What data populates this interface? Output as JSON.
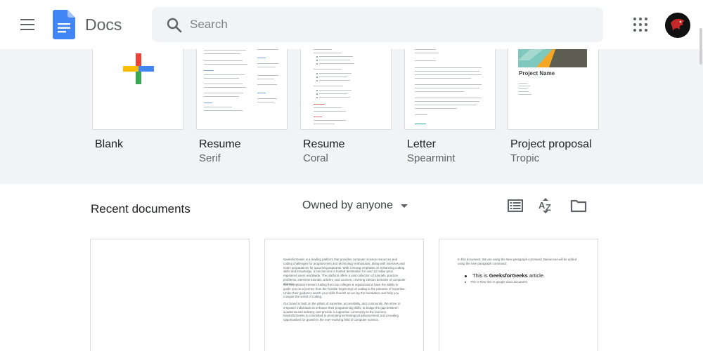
{
  "header": {
    "app_name": "Docs",
    "search_placeholder": "Search"
  },
  "templates": [
    {
      "name": "Blank",
      "subtitle": ""
    },
    {
      "name": "Resume",
      "subtitle": "Serif"
    },
    {
      "name": "Resume",
      "subtitle": "Coral"
    },
    {
      "name": "Letter",
      "subtitle": "Spearmint"
    },
    {
      "name": "Project proposal",
      "subtitle": "Tropic"
    }
  ],
  "proposal_thumb_title": "Project Name",
  "recent": {
    "title": "Recent documents",
    "owner_filter": "Owned by anyone"
  },
  "docs": {
    "doc2_text": "GeeksforGeeks is a leading platform that provides computer science resources and coding challenges for programmers and technology enthusiasts, along with interview and exam preparations for upcoming aspirants. With a strong emphasis on enhancing coding skills and knowledge, it has become a trusted destination for over 12 million plus registered users worldwide. The platform offers a vast collection of tutorials, practice problems, interview tutorials, articles, and courses, covering various domains of computer science.",
    "doc2_text2": "Our exceptional mentors hailing from top colleges & organizations have the ability to guide you on a journey from the humble beginnings of coding to the pinnacle of expertise. Under their guidance watch your skills flourish as we lay the foundation and help you conquer the world of coding.",
    "doc2_text3": "Our brand is built on the pillars of expertise, accessibility, and community. We strive to empower individuals to enhance their programming skills, to bridge the gap between academia and industry, and provide a supportive community to the learners. GeeksforGeeks is committed to promoting technological advancement and providing opportunities for growth in the ever-evolving field of computer science.",
    "doc3_intro": "In this document, We are using the New paragraph command. Below text will be added using the new paragraph command:",
    "doc3_bullet_prefix": "This is ",
    "doc3_bullet_bold": "GeeksforGeeks",
    "doc3_bullet_suffix": " article.",
    "doc3_bullet2": "This is New line in google docs document."
  },
  "colors": {
    "accent_blue": "#4285f4",
    "header_text": "#5f6368",
    "gallery_bg": "#f1f3f4"
  },
  "icons": [
    "menu-icon",
    "docs-logo-icon",
    "search-icon",
    "apps-grid-icon",
    "list-view-icon",
    "sort-az-icon",
    "folder-icon",
    "caret-down-icon"
  ]
}
